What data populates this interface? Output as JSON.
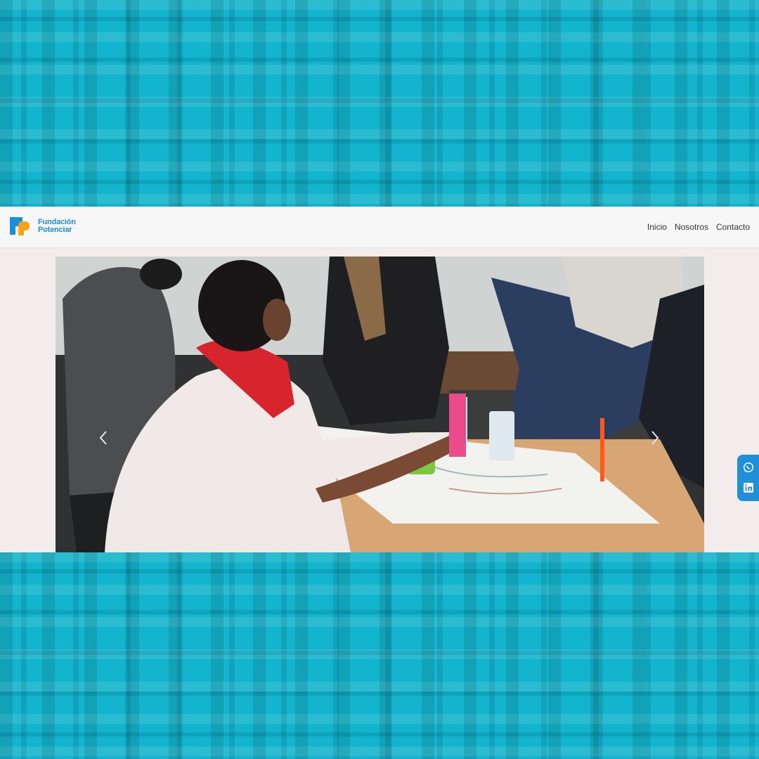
{
  "brand": {
    "name_line1": "Fundación",
    "name_line2": "Potenciar",
    "colors": {
      "blue": "#1b8fd6",
      "orange": "#f6a21e"
    }
  },
  "nav": {
    "links": [
      {
        "label": "Inicio",
        "icon": null
      },
      {
        "label": "Nosotros",
        "icon": null
      },
      {
        "label": "Contacto",
        "icon": null
      }
    ]
  },
  "hero": {
    "image_subject": "students-working-around-table-photo",
    "prev_icon": "chevron-left-icon",
    "next_icon": "chevron-right-icon"
  },
  "social": {
    "buttons": [
      {
        "icon": "whatsapp-icon"
      },
      {
        "icon": "linkedin-icon"
      }
    ],
    "accent": "#1e8fd8"
  },
  "background": {
    "color": "#13b4cd"
  }
}
